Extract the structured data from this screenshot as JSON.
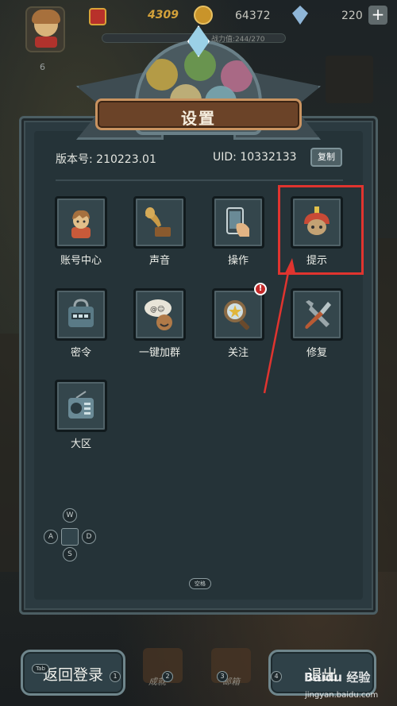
{
  "hud": {
    "red_value": "4309",
    "coins": "64372",
    "gems": "220",
    "power_text": "战力值:244/270",
    "level": "6",
    "plus_icon": "plus-icon"
  },
  "dialog": {
    "title": "设置",
    "version_label": "版本号: 210223.01",
    "uid_label": "UID: 10332133",
    "copy_button": "复制"
  },
  "grid": [
    {
      "label": "账号中心",
      "icon": "avatar-icon"
    },
    {
      "label": "声音",
      "icon": "gramophone-icon"
    },
    {
      "label": "操作",
      "icon": "phone-hand-icon"
    },
    {
      "label": "提示",
      "icon": "warrior-helmet-icon"
    },
    {
      "label": "密令",
      "icon": "cipher-box-icon"
    },
    {
      "label": "一键加群",
      "icon": "chat-group-icon"
    },
    {
      "label": "关注",
      "icon": "magnifier-star-icon",
      "badge": "!"
    },
    {
      "label": "修复",
      "icon": "wrench-screwdriver-icon"
    },
    {
      "label": "大区",
      "icon": "radio-icon"
    }
  ],
  "controls": {
    "dpad": {
      "up": "W",
      "left": "A",
      "right": "D",
      "down": "S"
    },
    "space_key": "空格",
    "tab_key": "Tab"
  },
  "bottom": {
    "back_login": "返回登录",
    "exit": "退出",
    "back_num": "1",
    "num2": "2",
    "num3": "3",
    "num4": "4",
    "caption2": "成就",
    "caption3": "邮箱"
  },
  "watermark": {
    "brand": "Baidu 经验",
    "url": "jingyan.baidu.com"
  },
  "colors": {
    "highlight": "#e0342f",
    "panel": "#2b3a40",
    "banner": "#6b4328"
  }
}
